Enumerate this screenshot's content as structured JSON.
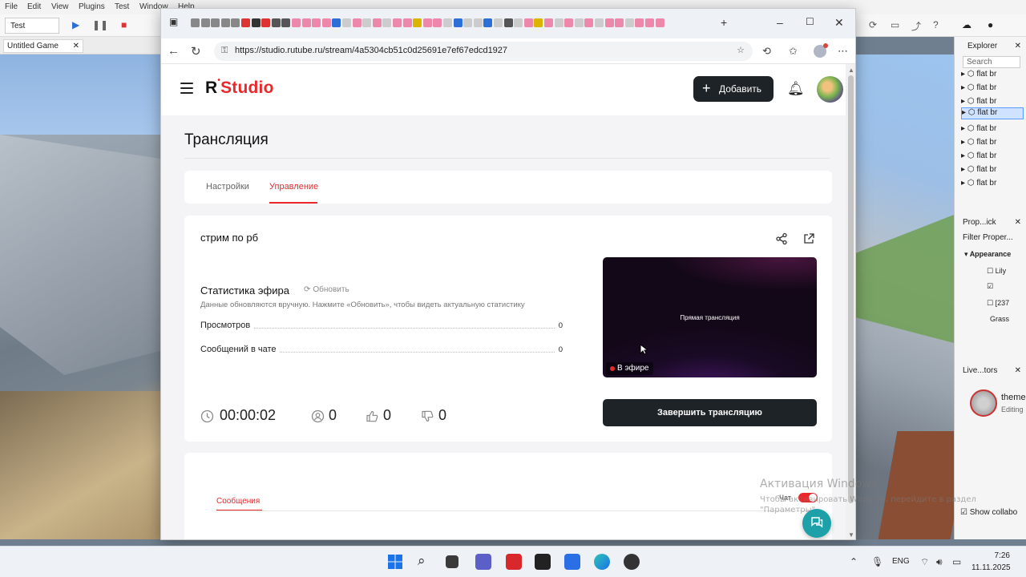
{
  "studio": {
    "menu": [
      "File",
      "Edit",
      "View",
      "Plugins",
      "Test",
      "Window",
      "Help"
    ],
    "mode_select": "Test",
    "game_tab": "Untitled Game",
    "explorer": {
      "title": "Explorer",
      "search_placeholder": "Search",
      "items": [
        "flat br",
        "flat br",
        "flat br",
        "flat br",
        "flat br",
        "flat br",
        "flat br",
        "flat br",
        "flat br"
      ],
      "selected_index": 3
    },
    "properties": {
      "title": "Prop...ick",
      "filter_placeholder": "Filter Proper...",
      "section": "Appearance",
      "rows": [
        "Lily",
        "",
        "[237",
        "Grass"
      ]
    },
    "live_editors": {
      "title": "Live...tors",
      "user": "theme",
      "status": "Editing"
    },
    "collab_checkbox": "Show collabo"
  },
  "browser": {
    "url": "https://studio.rutube.ru/stream/4a5304cb51c0d25691e7ef67edcd1927"
  },
  "site": {
    "logo_text": "Studio",
    "add_button": "Добавить",
    "page_title": "Трансляция",
    "tabs": [
      {
        "label": "Настройки",
        "active": false
      },
      {
        "label": "Управление",
        "active": true
      }
    ],
    "stream": {
      "name": "стрим по рб",
      "stats_title": "Статистика эфира",
      "refresh_label": "Обновить",
      "stats_note": "Данные обновляются вручную. Нажмите «Обновить», чтобы видеть актуальную статистику",
      "stats": [
        {
          "label": "Просмотров",
          "value": "0"
        },
        {
          "label": "Сообщений в чате",
          "value": "0"
        }
      ],
      "duration": "00:00:02",
      "viewers": "0",
      "likes": "0",
      "dislikes": "0",
      "preview_label": "Прямая трансляция",
      "live_badge": "В эфире",
      "end_button": "Завершить трансляцию"
    },
    "messages": {
      "tab_label": "Сообщения",
      "chat_toggle_label": "Чат",
      "chat_enabled": true
    }
  },
  "windows": {
    "activation_title": "Активация Windows",
    "activation_line1": "Чтобы активировать Windows, перейдите в раздел",
    "activation_line2": "\"Параметры\"",
    "lang": "ENG",
    "time": "7:26",
    "date": "11.11.2025"
  },
  "colors": {
    "brand_red": "#e8282b",
    "dark_button": "#1e2327",
    "support_teal": "#1da0a8"
  }
}
